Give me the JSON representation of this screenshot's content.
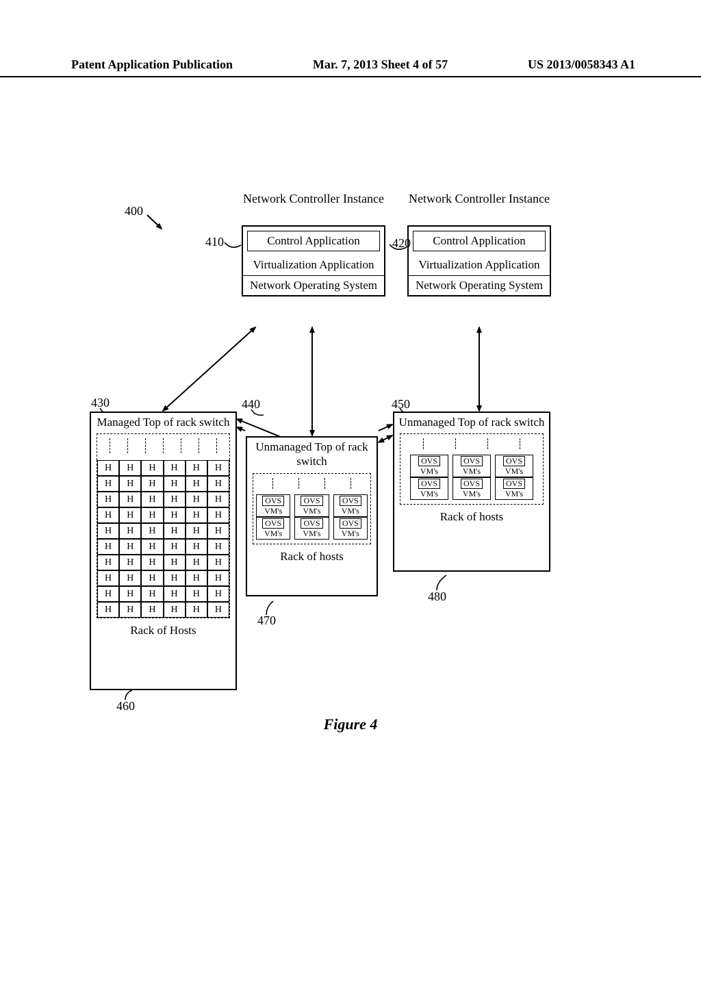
{
  "header": {
    "left": "Patent Application Publication",
    "center": "Mar. 7, 2013  Sheet 4 of 57",
    "right": "US 2013/0058343 A1"
  },
  "labels": {
    "nci": "Network Controller Instance",
    "control_app": "Control Application",
    "virt_app": "Virtualization Application",
    "nos": "Network Operating System",
    "managed_tor": "Managed Top of rack switch",
    "unmanaged_tor": "Unmanaged Top of rack switch",
    "rack_of_hosts": "Rack of Hosts",
    "rack_of_hosts_lc": "Rack of hosts",
    "ovs": "OVS",
    "vms": "VM's",
    "H": "H",
    "figure": "Figure 4"
  },
  "refs": {
    "r400": "400",
    "r410": "410",
    "r420": "420",
    "r430": "430",
    "r440": "440",
    "r450": "450",
    "r460": "460",
    "r470": "470",
    "r480": "480"
  },
  "layout": {
    "host_rows": 10,
    "host_cols": 6,
    "vm_rows_440": 2,
    "vm_rows_450": 2,
    "vm_cols": 3
  },
  "chart_data": {
    "type": "diagram",
    "title": "Figure 4",
    "nodes": [
      {
        "id": "400",
        "label": "System (overall ref)"
      },
      {
        "id": "410",
        "label": "Network Controller Instance (left)",
        "contains": [
          "Control Application",
          "Virtualization Application",
          "Network Operating System"
        ]
      },
      {
        "id": "420",
        "label": "Network Controller Instance (right)",
        "contains": [
          "Control Application",
          "Virtualization Application",
          "Network Operating System"
        ]
      },
      {
        "id": "430",
        "label": "Managed Top of rack switch",
        "caption": "Rack of Hosts",
        "hosts_ref": "460",
        "grid": {
          "rows": 10,
          "cols": 6,
          "cell": "H"
        }
      },
      {
        "id": "440",
        "label": "Unmanaged Top of rack switch",
        "caption": "Rack of hosts",
        "hosts_ref": "470",
        "vm_boxes": {
          "rows": 2,
          "cols": 3,
          "each": [
            "OVS",
            "VM's"
          ]
        }
      },
      {
        "id": "450",
        "label": "Unmanaged Top of rack switch",
        "caption": "Rack of hosts",
        "hosts_ref": "480",
        "vm_boxes": {
          "rows": 2,
          "cols": 3,
          "each": [
            "OVS",
            "VM's"
          ]
        }
      },
      {
        "id": "460",
        "label": "Rack of Hosts (ref)"
      },
      {
        "id": "470",
        "label": "Rack of hosts (ref)"
      },
      {
        "id": "480",
        "label": "Rack of hosts (ref)"
      }
    ],
    "edges": [
      {
        "from": "410",
        "to": "430",
        "bidirectional": true
      },
      {
        "from": "410",
        "to": "440",
        "bidirectional": true
      },
      {
        "from": "420",
        "to": "450",
        "bidirectional": true
      },
      {
        "from": "430",
        "to": "440",
        "bidirectional": true
      },
      {
        "from": "440",
        "to": "450",
        "bidirectional": true
      },
      {
        "from": "430",
        "to": "450",
        "bidirectional": true
      }
    ]
  }
}
